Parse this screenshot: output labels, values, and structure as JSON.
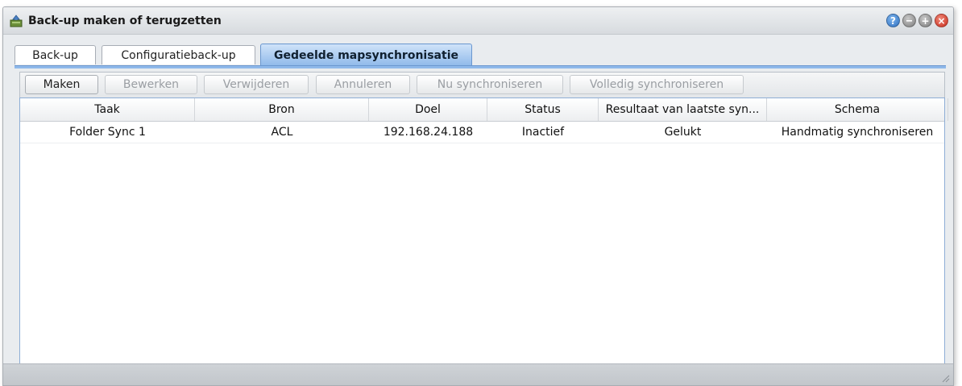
{
  "window": {
    "title": "Back-up maken of terugzetten",
    "icon": "backup-app-icon",
    "controls": [
      "help-icon",
      "minimize-icon",
      "maximize-icon",
      "close-icon"
    ],
    "control_glyphs": {
      "help": "?",
      "minimize": "",
      "maximize": "+",
      "close": "×"
    }
  },
  "tabs": [
    {
      "label": "Back-up",
      "active": false
    },
    {
      "label": "Configuratieback-up",
      "active": false
    },
    {
      "label": "Gedeelde mapsynchronisatie",
      "active": true
    }
  ],
  "toolbar": {
    "buttons": [
      {
        "label": "Maken",
        "enabled": true
      },
      {
        "label": "Bewerken",
        "enabled": false
      },
      {
        "label": "Verwijderen",
        "enabled": false
      },
      {
        "label": "Annuleren",
        "enabled": false
      },
      {
        "label": "Nu synchroniseren",
        "enabled": false
      },
      {
        "label": "Volledig synchroniseren",
        "enabled": false
      }
    ]
  },
  "table": {
    "columns": [
      "Taak",
      "Bron",
      "Doel",
      "Status",
      "Resultaat van laatste syn...",
      "Schema"
    ],
    "rows": [
      [
        "Folder Sync 1",
        "ACL",
        "192.168.24.188",
        "Inactief",
        "Gelukt",
        "Handmatig synchroniseren"
      ]
    ]
  },
  "colors": {
    "active_tab": "#8fb9ea",
    "close_button": "#c92b1b",
    "help_button": "#2d6fc0"
  }
}
